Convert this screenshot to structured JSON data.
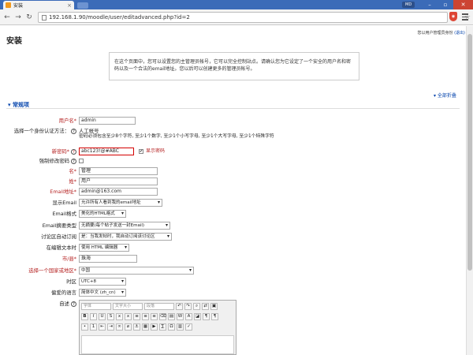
{
  "browser": {
    "tab_title": "安装",
    "url": "192.168.1.90/moodle/user/editadvanced.php?id=2",
    "user_chip": "MD"
  },
  "page": {
    "title": "安装",
    "login_info_prefix": "您以用户管理员身份",
    "login_info_link": "(退出)",
    "notice": "在这个页面中，您可以设置您的主管理员帐号，它可以完全控制站点。请确认您为它设定了一个安全的用户名和密码以及一个合法的email地址。您以后可以创建更多的管理员帐号。",
    "collapse_all": "全部折叠",
    "section": "常规项"
  },
  "form": {
    "username_label": "用户名*",
    "username_value": "admin",
    "auth_label": "选择一个身份认证方法：",
    "auth_value": "人工帐号",
    "password_rules": "密码必须包含至少8个字符, 至少1个数字, 至少1个小写字母, 至少1个大写字母, 至少1个特殊字符",
    "password_label": "新密码*",
    "password_value": "abc123!@#ABC",
    "show_password": "显示密码",
    "force_change_label": "强制修改密码",
    "firstname_label": "名*",
    "firstname_value": "管理",
    "lastname_label": "姓*",
    "lastname_value": "用户",
    "email_label": "Email地址*",
    "email_value": "admin@163.com",
    "display_email_label": "显示Email",
    "display_email_value": "允许所有人看到我的email地址",
    "email_format_label": "Email格式",
    "email_format_value": "美化的HTML格式",
    "digest_label": "Email摘要类型",
    "digest_value": "无摘要(每个帖子发送一封Email)",
    "autosub_label": "讨论区自动订阅",
    "autosub_value": "是：当我发帖时，我自动订阅该讨论区",
    "editor_label": "在编辑文本时",
    "editor_value": "使用 HTML 编辑器",
    "city_label": "市/县*",
    "city_value": "珠海",
    "country_label": "选择一个国家或地区*",
    "country_value": "中国",
    "timezone_label": "时区",
    "timezone_value": "UTC+8",
    "lang_label": "偏爱的语言",
    "lang_value": "简体中文 (zh_cn)",
    "desc_label": "自述",
    "editor_font": "字体",
    "editor_size": "文字大小",
    "editor_para": "段落"
  }
}
